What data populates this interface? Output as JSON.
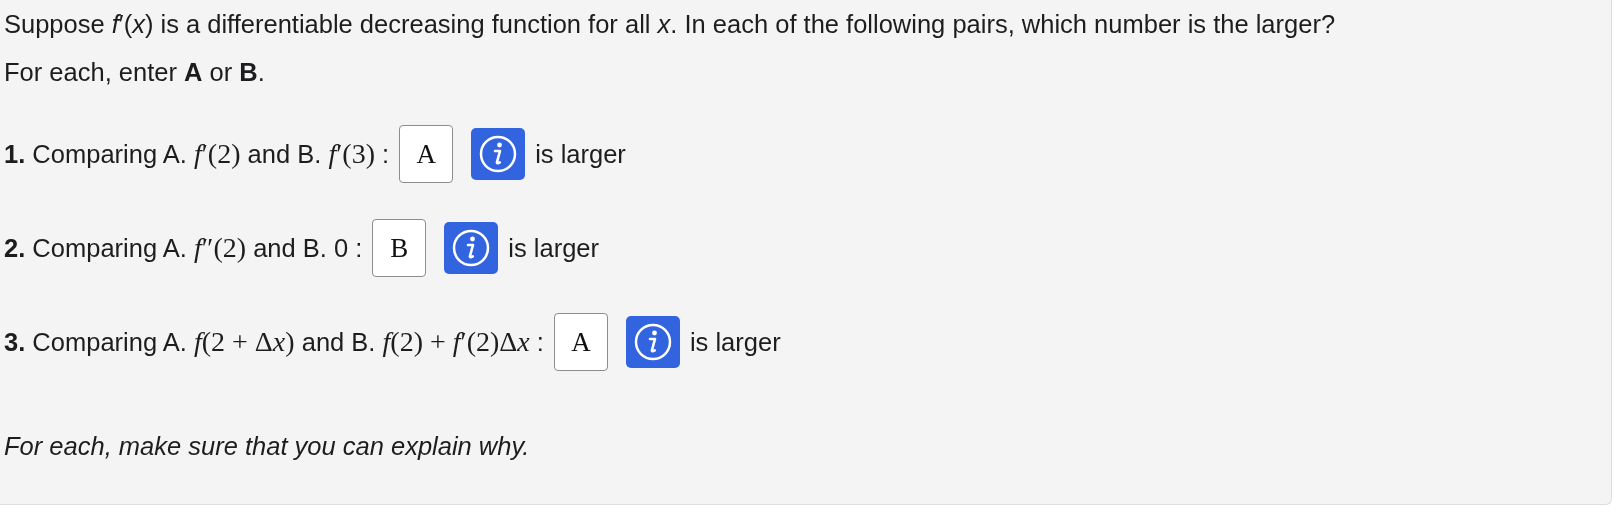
{
  "intro": "Suppose *f*′(*x*) is a differentiable decreasing function for all *x*. In each of the following pairs, which number is the larger?",
  "instruction": "For each, enter **A** or **B**.",
  "items": [
    {
      "number": "1.",
      "lead": "Comparing A.",
      "math_a": "f′(2)",
      "middle": "and B.",
      "math_b": "f′(3)",
      "colon": ":",
      "answer": "A",
      "suffix": "is larger"
    },
    {
      "number": "2.",
      "lead": "Comparing A.",
      "math_a": "f″(2)",
      "middle": "and B. 0",
      "colon": ":",
      "answer": "B",
      "suffix": "is larger"
    },
    {
      "number": "3.",
      "lead": "Comparing A.",
      "math_a": "f(2 + Δx)",
      "middle": "and B.",
      "math_b": "f(2) + f′(2)Δx",
      "colon": ":",
      "answer": "A",
      "suffix": "is larger"
    }
  ],
  "footer": "For each, make sure that you can explain why."
}
